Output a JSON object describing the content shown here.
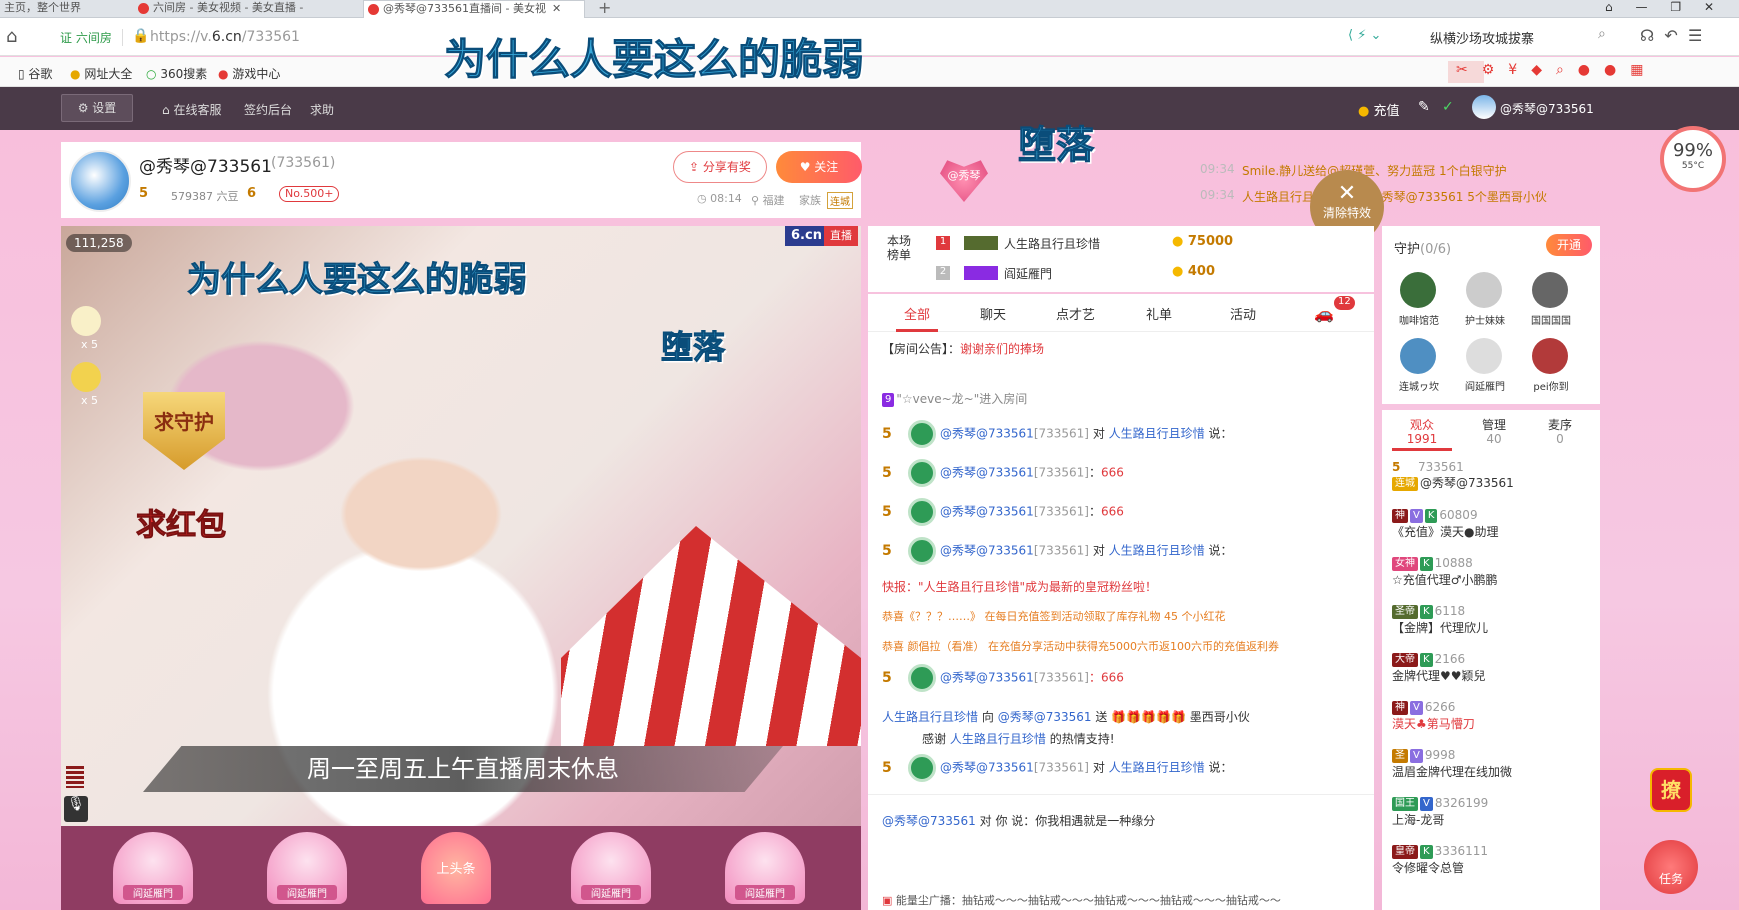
{
  "tabs": [
    "主页，整个世界",
    "六间房 - 美女视频 - 美女直播 -",
    "@秀琴@733561直播间 - 美女视"
  ],
  "address": {
    "badge": "证 六间房",
    "url_prefix": "https://v.",
    "url_domain": "6.cn",
    "url_path": "/733561",
    "search": "纵横沙场攻城拔寨"
  },
  "bookmarks": [
    "谷歌",
    "网址大全",
    "360搜素",
    "游戏中心"
  ],
  "site": {
    "settings": "设置",
    "service": "在线客服",
    "backend": "签约后台",
    "help": "求助",
    "recharge": "充值",
    "user": "@秀琴@733561"
  },
  "overlay": {
    "big": "为什么人要这么的脆弱",
    "small": "堕落",
    "video_big": "为什么人要这么的脆弱",
    "video_small": "堕落",
    "banner": "周一至周五上午直播周末休息"
  },
  "anchor": {
    "name": "@秀琴@733561",
    "id": "(733561)",
    "level": "5",
    "beans": "579387 六豆",
    "fans_level": "6",
    "rank": "No.500+",
    "time": "08:14",
    "location": "福建",
    "family": "家族",
    "family_tag": "连城",
    "share": "分享有奖",
    "follow": "关注",
    "heart_name": "@秀琴"
  },
  "notices": [
    {
      "time": "09:34",
      "text": "Smile.静儿送给@超瑾萱、努力蓝冠 1个白银守护"
    },
    {
      "time": "09:34",
      "text": "人生路且行且珍惜 送给 @秀琴@733561 5个墨西哥小伙"
    }
  ],
  "clear_effects": "清除特效",
  "cpu": {
    "percent": "99%",
    "temp": "55°C"
  },
  "video": {
    "coins": "111,258",
    "logo": "6.cn",
    "live": "直播",
    "x5a": "x 5",
    "x5b": "x 5",
    "guard": "求守护",
    "redpack": "求红包"
  },
  "seats": [
    "阎延雁門",
    "阎延雁門",
    "上头条",
    "阎延雁門",
    "阎延雁門"
  ],
  "rank": {
    "label": "本场榜单",
    "rows": [
      {
        "n": "1",
        "name": "人生路且行且珍惜",
        "value": "75000"
      },
      {
        "n": "2",
        "name": "阎延雁門",
        "value": "400"
      }
    ]
  },
  "chat_tabs": [
    "全部",
    "聊天",
    "点才艺",
    "礼单",
    "活动"
  ],
  "car_badge": "12",
  "announce": {
    "label": "【房间公告】：",
    "text": "谢谢亲们的捧场"
  },
  "enter": "\"☆veve~龙~\"进入房间",
  "messages": [
    {
      "name": "@秀琴@733561",
      "id": "[733561]",
      "mid": "对",
      "target": "人生路且行且珍惜",
      "tail": "说："
    },
    {
      "name": "@秀琴@733561",
      "id": "[733561]",
      "mid": "：",
      "target": "",
      "tail": "666"
    },
    {
      "name": "@秀琴@733561",
      "id": "[733561]",
      "mid": "：",
      "target": "",
      "tail": "666"
    },
    {
      "name": "@秀琴@733561",
      "id": "[733561]",
      "mid": "对",
      "target": "人生路且行且珍惜",
      "tail": "说："
    }
  ],
  "news1": "快报：\"人生路且行且珍惜\"成为最新的皇冠粉丝啦！",
  "news2": "恭喜《？？？……》 在每日充值签到活动领取了库存礼物 45 个小红花",
  "news3": "恭喜 颜倡拉（看准） 在充值分享活动中获得充5000六币返100六币的充值返利券",
  "msg5": {
    "name": "@秀琴@733561",
    "id": "[733561]",
    "tail": "：666"
  },
  "gift": {
    "from": "人生路且行且珍惜",
    "verb": "向",
    "to": "@秀琴@733561",
    "send": "送",
    "item": "墨西哥小伙",
    "line2a": "感谢",
    "line2b": "人生路且行且珍惜",
    "line2c": "的热情支持!"
  },
  "msg6": {
    "name": "@秀琴@733561",
    "id": "[733561]",
    "mid": "对",
    "target": "人生路且行且珍惜",
    "tail": "说："
  },
  "private": {
    "name": "@秀琴@733561",
    "text": "对 你 说：你我相遇就是一种缘分"
  },
  "broadcast": "能量尘广播：抽钻戒～～～抽钻戒～～～抽钻戒～～～抽钻戒～～～抽钻戒～～",
  "guard": {
    "title": "守护",
    "count": "(0/6)",
    "open": "开通",
    "members": [
      "咖啡馆范",
      "护士妹妹",
      "国国国国",
      "连城ヮ坎",
      "阎延雁門",
      "pei你到"
    ]
  },
  "aud_tabs": [
    {
      "label": "观众",
      "count": "1991"
    },
    {
      "label": "管理",
      "count": "40"
    },
    {
      "label": "麦序",
      "count": "0"
    }
  ],
  "audience": [
    {
      "num": "733561",
      "name": "@秀琴@733561",
      "tag": "连城"
    },
    {
      "num": "60809",
      "name": "《充值》漠天●助理",
      "tag": "神"
    },
    {
      "num": "10888",
      "name": "☆充值代理♂小鹏鹏",
      "tag": "女神"
    },
    {
      "num": "6118",
      "name": "【金牌】代理欣儿",
      "tag": "圣帝"
    },
    {
      "num": "2166",
      "name": "金牌代理♥♥颖兒",
      "tag": "大帝"
    },
    {
      "num": "6266",
      "name": "漠天♣第马懵刀",
      "tag": "神"
    },
    {
      "num": "9998",
      "name": "温眉金牌代理在线加微",
      "tag": "圣"
    },
    {
      "num": "8326199",
      "name": "上海-龙哥",
      "tag": "国王"
    },
    {
      "num": "3336111",
      "name": "令修曜令总管",
      "tag": "皇帝"
    }
  ],
  "side_buttons": {
    "liao": "撩",
    "task": "任务"
  }
}
